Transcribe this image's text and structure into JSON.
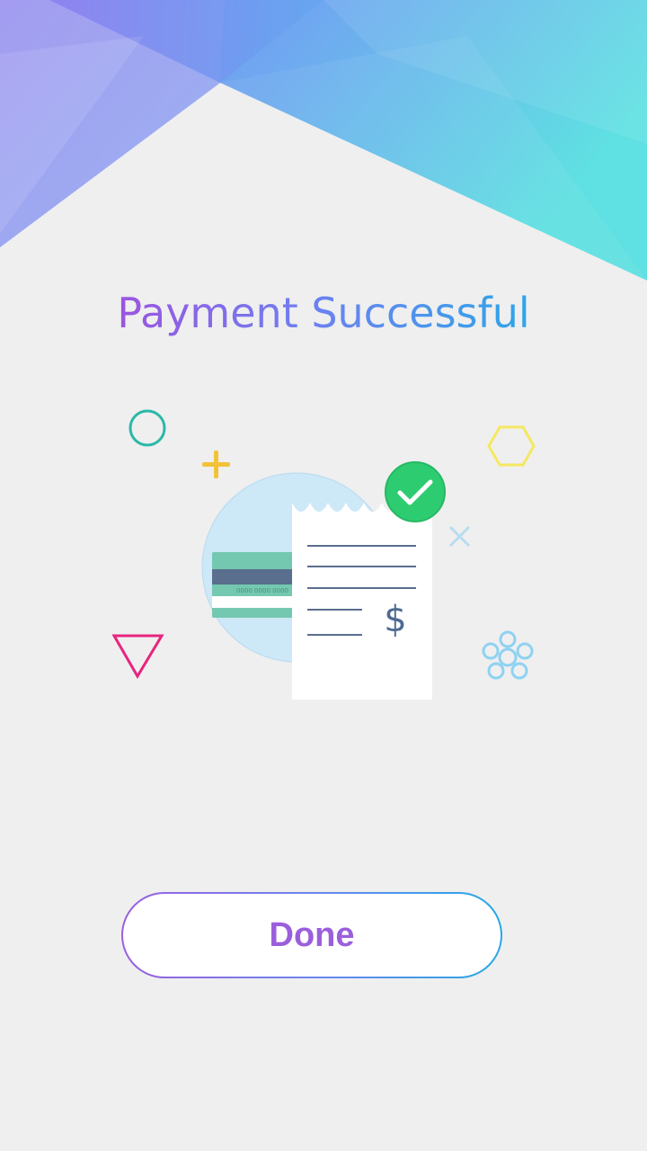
{
  "screen": {
    "title": "Payment Successful"
  },
  "illustration": {
    "icons": [
      "circle-icon",
      "plus-icon",
      "hexagon-icon",
      "cross-icon",
      "triangle-icon",
      "flower-icon",
      "check-icon",
      "credit-card-icon",
      "receipt-icon"
    ],
    "card_number_text": "0000 0000 0000",
    "currency_symbol": "$"
  },
  "actions": {
    "done_label": "Done"
  },
  "colors": {
    "title_gradient_start": "#9b55e0",
    "title_gradient_end": "#2fa6e8",
    "check_green": "#2ecc71",
    "card_green": "#74c8b0",
    "background": "#efefef"
  }
}
